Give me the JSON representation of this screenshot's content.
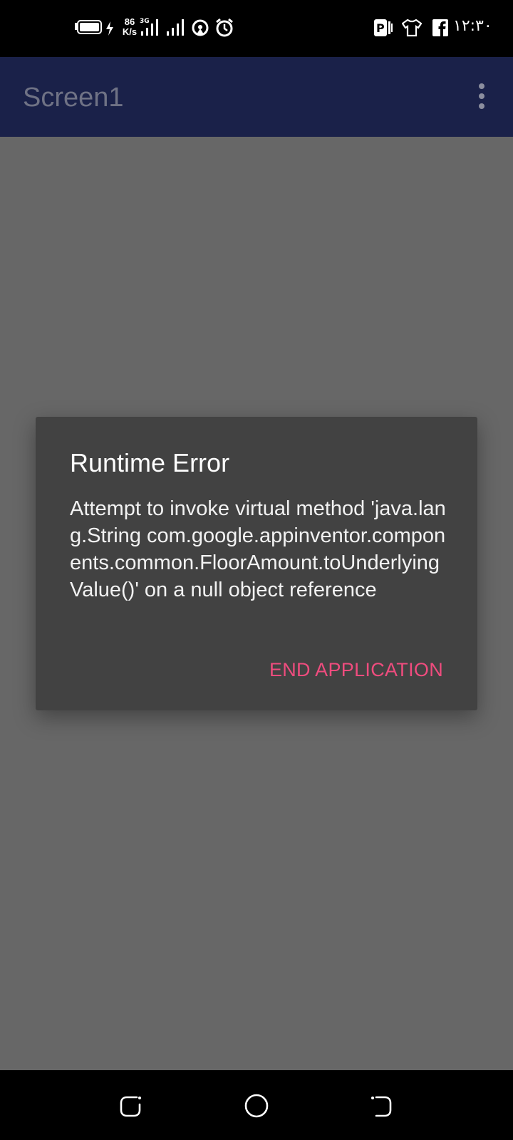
{
  "status_bar": {
    "net_speed_value": "86",
    "net_speed_unit": "K/s",
    "clock": "١٢:٣٠",
    "icons": [
      "battery-icon",
      "charging-icon",
      "signal-icon",
      "signal-icon",
      "hotspot-icon",
      "alarm-icon",
      "parking-app-icon",
      "shirt-app-icon",
      "facebook-icon"
    ]
  },
  "app_bar": {
    "title": "Screen1",
    "menu_icon": "overflow-menu-icon"
  },
  "dialog": {
    "title": "Runtime Error",
    "message": "Attempt to invoke virtual method 'java.lang.String com.google.appinventor.components.common.FloorAmount.toUnderlyingValue()' on a null object reference",
    "button_label": "END APPLICATION",
    "accent_color": "#ef4c7e"
  },
  "nav_bar": {
    "icons": [
      "recents-icon",
      "home-icon",
      "back-icon"
    ]
  }
}
